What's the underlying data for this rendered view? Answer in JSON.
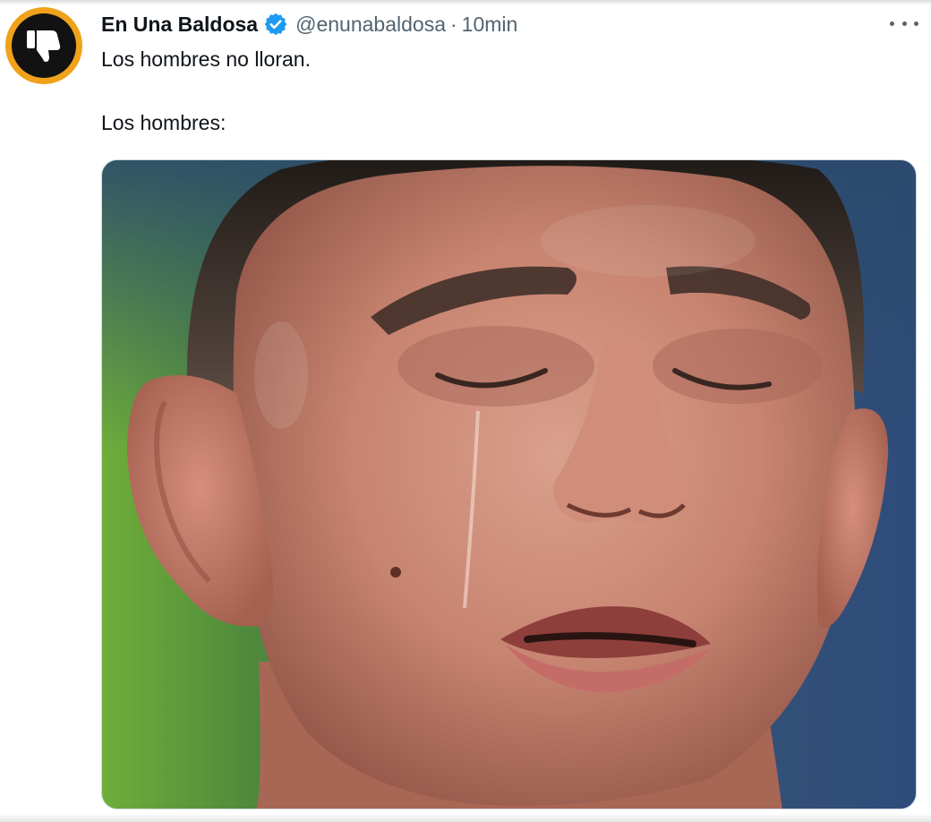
{
  "tweet": {
    "display_name": "En Una Baldosa",
    "handle": "@enunabaldosa",
    "separator": "·",
    "time": "10min",
    "text_line1": "Los hombres no lloran.",
    "text_line2": "Los hombres:"
  },
  "avatar": {
    "icon": "thumbs-down-icon",
    "ring_color": "#f0a21b",
    "bg_color": "#121212"
  },
  "verified_badge": {
    "icon": "verified-badge-icon",
    "color": "#1d9bf0"
  },
  "more_menu": {
    "icon": "more-options-icon"
  },
  "media": {
    "type": "photo",
    "icon": "crying-man-photo"
  }
}
